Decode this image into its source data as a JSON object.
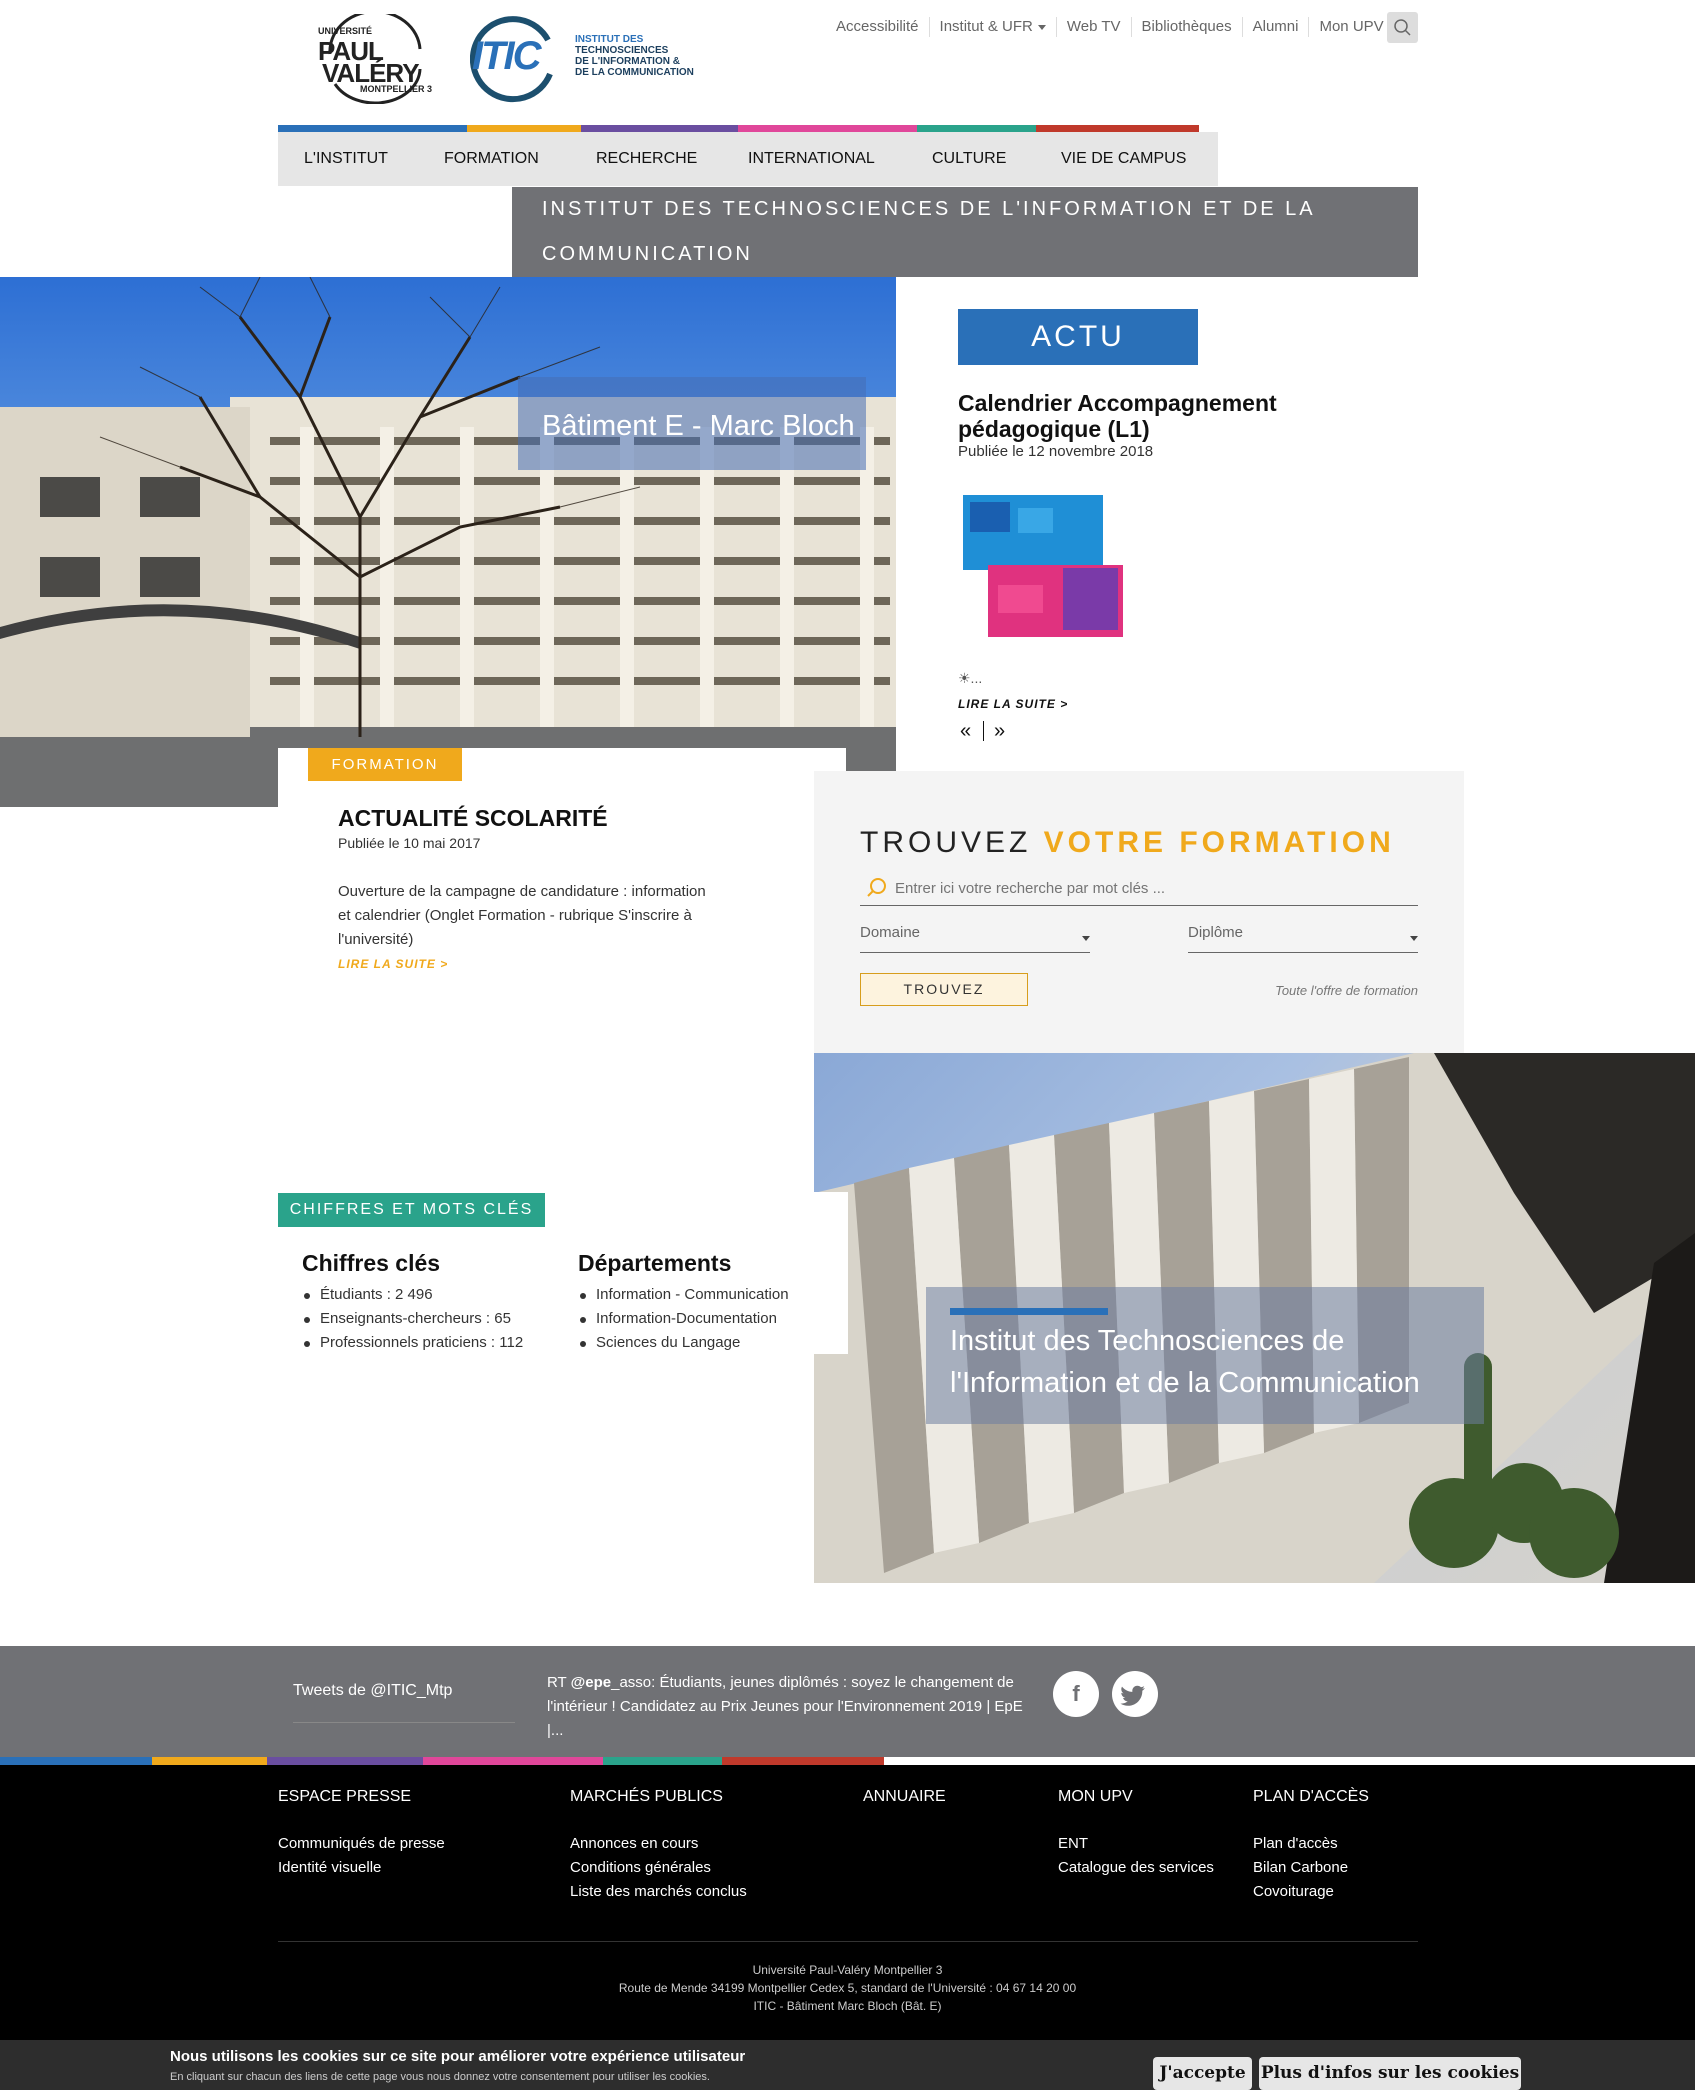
{
  "header": {
    "logo_upv": {
      "line1": "UNIVERSITÉ",
      "line2": "PAUL",
      "line3": "VALÉRY",
      "line4": "MONTPELLIER 3"
    },
    "logo_itic": {
      "mark": "ITIC",
      "line1": "INSTITUT DES",
      "line2": "TECHNOSCIENCES",
      "line3": "DE L'INFORMATION &",
      "line4": "DE LA COMMUNICATION"
    },
    "top_links": [
      "Accessibilité",
      "Institut & UFR",
      "Web TV",
      "Bibliothèques",
      "Alumni",
      "Mon UPV"
    ],
    "colors": [
      "#2a70b8",
      "#f0a91c",
      "#6a4ea0",
      "#e0479a",
      "#2aa38b",
      "#c0392b"
    ]
  },
  "nav": {
    "items": [
      "L'INSTITUT",
      "FORMATION",
      "RECHERCHE",
      "INTERNATIONAL",
      "CULTURE",
      "VIE DE CAMPUS"
    ]
  },
  "band": {
    "title": "INSTITUT DES TECHNOSCIENCES DE L'INFORMATION ET DE LA COMMUNICATION"
  },
  "hero": {
    "title": "Bâtiment E - Marc Bloch"
  },
  "actu": {
    "button": "ACTU",
    "title": "Calendrier Accompagnement pédagogique (L1)",
    "date": "Publiée le 12 novembre 2018",
    "excerpt": "☀...",
    "more": "LIRE LA SUITE >",
    "prev": "«",
    "next": "»"
  },
  "formation_news": {
    "tag": "FORMATION",
    "title": "ACTUALITÉ SCOLARITÉ",
    "date": "Publiée le 10 mai 2017",
    "text": "Ouverture de la campagne de candidature : information et calendrier (Onglet Formation - rubrique S'inscrire à l'université)",
    "more": "LIRE LA SUITE >"
  },
  "search": {
    "title_plain": "TROUVEZ ",
    "title_strong": "VOTRE FORMATION",
    "placeholder": "Entrer ici votre recherche par mot clés ...",
    "domain_label": "Domaine",
    "diploma_label": "Diplôme",
    "button": "TROUVEZ",
    "all_link": "Toute l'offre de formation"
  },
  "facade": {
    "title": "Institut des Technosciences de l'Information et de la Communication"
  },
  "chiffres": {
    "tag": "CHIFFRES ET MOTS CLÉS",
    "col1_title": "Chiffres clés",
    "col1_items": [
      "Étudiants : 2 496",
      "Enseignants-chercheurs : 65",
      "Professionnels praticiens : 112"
    ],
    "col2_title": "Départements",
    "col2_items": [
      "Information - Communication",
      "Information-Documentation",
      "Sciences du Langage"
    ]
  },
  "tweets": {
    "label": "Tweets de @ITIC_Mtp",
    "text_prefix": "RT ",
    "handle": "@epe",
    "text": "_asso: Étudiants, jeunes diplômés : soyez le changement de l'intérieur ! Candidatez au Prix Jeunes pour l'Environnement 2019 | EpE |...",
    "facebook": "f",
    "twitter": "t"
  },
  "footer": {
    "columns": [
      {
        "title": "ESPACE PRESSE",
        "links": [
          "Communiqués de presse",
          "Identité visuelle"
        ]
      },
      {
        "title": "MARCHÉS PUBLICS",
        "links": [
          "Annonces en cours",
          "Conditions générales",
          "Liste des marchés conclus"
        ]
      },
      {
        "title": "ANNUAIRE",
        "links": []
      },
      {
        "title": "MON UPV",
        "links": [
          "ENT",
          "Catalogue des services"
        ]
      },
      {
        "title": "PLAN D'ACCÈS",
        "links": [
          "Plan d'accès",
          "Bilan Carbone",
          "Covoiturage"
        ]
      }
    ],
    "address_line1": "Université Paul-Valéry Montpellier 3",
    "address_line2": "Route de Mende 34199 Montpellier Cedex 5, standard de l'Université : 04 67 14 20 00",
    "address_line3": "ITIC - Bâtiment Marc Bloch (Bât. E)"
  },
  "cookie": {
    "title": "Nous utilisons les cookies sur ce site pour améliorer votre expérience utilisateur",
    "subtitle": "En cliquant sur chacun des liens de cette page vous nous donnez votre consentement pour utiliser les cookies.",
    "accept": "J'accepte",
    "more": "Plus d'infos sur les cookies"
  }
}
